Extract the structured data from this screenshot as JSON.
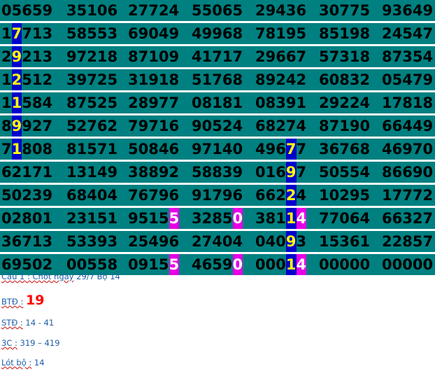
{
  "grid": {
    "rows": [
      [
        "05659",
        "35106",
        "27724",
        "55065",
        "29436",
        "30775",
        "93649"
      ],
      [
        "17713",
        "58553",
        "69049",
        "49968",
        "78195",
        "85198",
        "24547"
      ],
      [
        "29213",
        "97218",
        "87109",
        "41717",
        "29667",
        "57318",
        "87354"
      ],
      [
        "12512",
        "39725",
        "31918",
        "51768",
        "89242",
        "60832",
        "05479"
      ],
      [
        "11584",
        "87525",
        "28977",
        "08181",
        "08391",
        "29224",
        "17818"
      ],
      [
        "89927",
        "52762",
        "79716",
        "90524",
        "68274",
        "87190",
        "66449"
      ],
      [
        "71808",
        "81571",
        "50846",
        "97140",
        "49677",
        "36768",
        "46970"
      ],
      [
        "62171",
        "13149",
        "38892",
        "58839",
        "01697",
        "50554",
        "86690"
      ],
      [
        "50239",
        "68404",
        "76796",
        "91796",
        "66224",
        "10295",
        "17772"
      ],
      [
        "02801",
        "23151",
        "95155",
        "32850",
        "38114",
        "77064",
        "66327"
      ],
      [
        "36713",
        "53393",
        "25496",
        "27404",
        "04093",
        "15361",
        "22857"
      ],
      [
        "69502",
        "00558",
        "09155",
        "46590",
        "00014",
        "00000",
        "00000"
      ]
    ],
    "highlights_blue": [
      [
        1,
        0,
        1
      ],
      [
        2,
        0,
        1
      ],
      [
        3,
        0,
        1
      ],
      [
        4,
        0,
        1
      ],
      [
        5,
        0,
        1
      ],
      [
        6,
        0,
        1
      ],
      [
        6,
        4,
        3
      ],
      [
        7,
        4,
        3
      ],
      [
        8,
        4,
        3
      ],
      [
        9,
        4,
        3
      ],
      [
        10,
        4,
        3
      ],
      [
        11,
        4,
        3
      ]
    ],
    "highlights_magenta": [
      [
        9,
        2,
        4
      ],
      [
        9,
        3,
        4
      ],
      [
        9,
        4,
        4
      ],
      [
        11,
        2,
        4
      ],
      [
        11,
        3,
        4
      ],
      [
        11,
        4,
        4
      ]
    ],
    "colors": {
      "teal": "#008080",
      "blue": "#0000cc",
      "magenta": "#e600e6",
      "yellow": "#ffff00"
    }
  },
  "notes": {
    "line1": {
      "label": "Câu 1 : Chốt ngày",
      "value": " 29/7 Bộ 14"
    },
    "line2": {
      "label": "BTĐ :",
      "value": "19"
    },
    "line3": {
      "label": "STĐ :",
      "value": " 14 - 41"
    },
    "line4": {
      "label": "3C :",
      "value": " 319  – 419"
    },
    "line5": {
      "label": "Lót bộ :",
      "value": " 14"
    }
  }
}
